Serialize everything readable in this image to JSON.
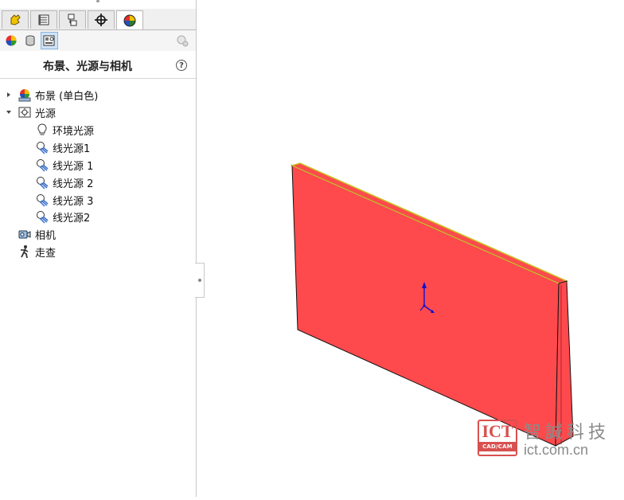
{
  "panel": {
    "title": "布景、光源与相机",
    "help_label": "?",
    "tabs": [
      {
        "icon": "feature-manager-icon"
      },
      {
        "icon": "property-manager-icon"
      },
      {
        "icon": "configuration-manager-icon"
      },
      {
        "icon": "dimxpert-manager-icon"
      },
      {
        "icon": "display-manager-icon",
        "active": true
      }
    ],
    "subtools": [
      {
        "icon": "appearances-icon"
      },
      {
        "icon": "decals-icon"
      },
      {
        "icon": "scene-lights-cameras-icon",
        "active": true
      }
    ]
  },
  "tree": {
    "scene": "布景 (单白色)",
    "lights": "光源",
    "light_items": [
      "环境光源",
      "线光源1",
      "线光源 1",
      "线光源 2",
      "线光源 3",
      "线光源2"
    ],
    "camera": "相机",
    "walkthrough": "走查"
  },
  "model": {
    "face_color": "#ff4a4d",
    "edge_color": "#e8e030"
  },
  "watermark": {
    "logo": "ICT",
    "logo_sub": "CAD/CAM",
    "name_cn": "智誠科技",
    "url": "ict.com.cn"
  }
}
